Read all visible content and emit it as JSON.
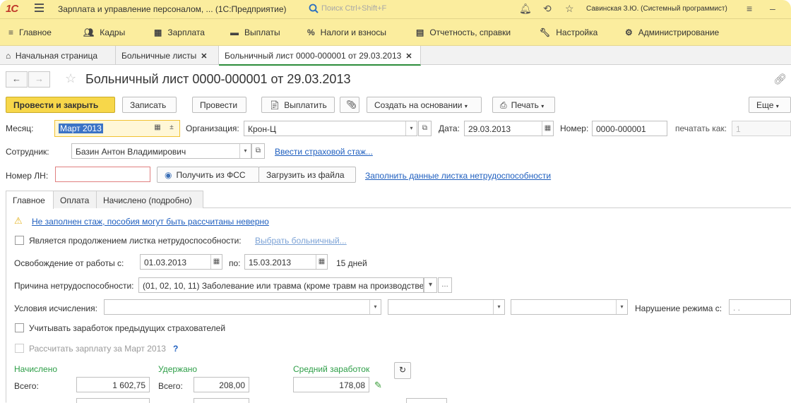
{
  "titlebar": {
    "logo": "1С",
    "app_title": "Зарплата и управление персоналом, ...  (1С:Предприятие)",
    "search_placeholder": "Поиск Ctrl+Shift+F",
    "user": "Савинская З.Ю. (Системный программист)"
  },
  "mainmenu": {
    "items": [
      {
        "label": "Главное",
        "icon": "hamburger-icon"
      },
      {
        "label": "Кадры",
        "icon": "people-icon"
      },
      {
        "label": "Зарплата",
        "icon": "calculator-icon"
      },
      {
        "label": "Выплаты",
        "icon": "wallet-icon"
      },
      {
        "label": "Налоги и взносы",
        "icon": "percent-icon"
      },
      {
        "label": "Отчетность, справки",
        "icon": "report-icon"
      },
      {
        "label": "Настройка",
        "icon": "wrench-icon"
      },
      {
        "label": "Администрирование",
        "icon": "gear-icon"
      }
    ]
  },
  "tabs": [
    {
      "label": "Начальная страница",
      "closable": false
    },
    {
      "label": "Больничные листы",
      "closable": true
    },
    {
      "label": "Больничный лист 0000-000001 от 29.03.2013",
      "closable": true,
      "active": true
    }
  ],
  "form": {
    "title": "Больничный лист 0000-000001 от 29.03.2013",
    "commands": {
      "post_close": "Провести и закрыть",
      "save": "Записать",
      "post": "Провести",
      "pay": "Выплатить",
      "create_based": "Создать на основании",
      "print": "Печать",
      "more": "Еще"
    },
    "month_label": "Месяц:",
    "month_value": "Март 2013",
    "org_label": "Организация:",
    "org_value": "Крон-Ц",
    "date_label": "Дата:",
    "date_value": "29.03.2013",
    "number_label": "Номер:",
    "number_value": "0000-000001",
    "print_as_label": "печатать как:",
    "print_as_value": "1",
    "employee_label": "Сотрудник:",
    "employee_value": "Базин Антон Владимирович",
    "insurance_link": "Ввести страховой стаж...",
    "ln_label": "Номер ЛН:",
    "ln_value": "",
    "get_fss": "Получить из ФСС",
    "load_file": "Загрузить из файла",
    "fill_link": "Заполнить данные листка нетрудоспособности"
  },
  "inner_tabs": [
    "Главное",
    "Оплата",
    "Начислено (подробно)"
  ],
  "main_tab": {
    "warning_link": "Не заполнен стаж, пособия могут быть рассчитаны неверно",
    "continuation_label": "Является продолжением листка нетрудоспособности:",
    "continuation_link": "Выбрать больничный...",
    "release_label": "Освобождение от работы с:",
    "release_from": "01.03.2013",
    "release_to_label": "по:",
    "release_to": "15.03.2013",
    "days": "15 дней",
    "reason_label": "Причина нетрудоспособности:",
    "reason_value": "(01, 02, 10, 11) Заболевание или травма (кроме травм на производстве)",
    "conditions_label": "Условия исчисления:",
    "violation_label": "Нарушение режима с:",
    "violation_value": ". .",
    "prev_insurers_label": "Учитывать заработок предыдущих страхователей",
    "calc_salary_label": "Рассчитать зарплату за Март 2013",
    "help_mark": "?",
    "accrued_title": "Начислено",
    "withheld_title": "Удержано",
    "avg_title": "Средний заработок",
    "total_label": "Всего:",
    "accrued_total": "1 602,75",
    "withheld_label": "Всего:",
    "withheld_total": "208,00",
    "avg_value": "178,08"
  },
  "colors": {
    "chrome_yellow": "#fbed9e",
    "primary_button": "#f7d74a",
    "link_blue": "#1f5fbf",
    "green": "#2d9e47",
    "active_tab_underline": "#2c8d3b"
  }
}
